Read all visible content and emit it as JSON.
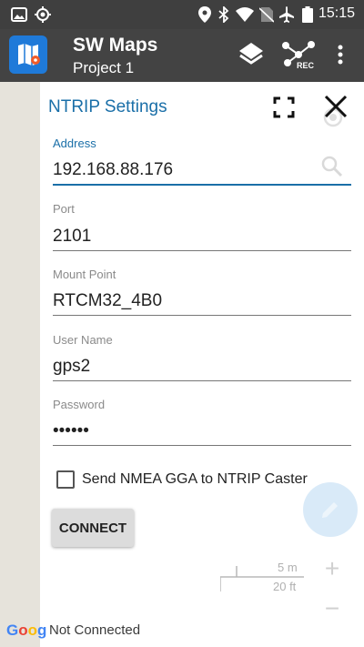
{
  "status_bar": {
    "time": "15:15",
    "icons": [
      "image-icon",
      "gps-target-icon",
      "location-pin-icon",
      "bluetooth-icon",
      "wifi-icon",
      "no-sim-icon",
      "airplane-icon",
      "battery-icon"
    ]
  },
  "app_bar": {
    "title": "SW Maps",
    "subtitle": "Project 1",
    "actions": [
      "layers-icon",
      "record-track-icon",
      "more-vert-icon"
    ],
    "rec_label": "REC"
  },
  "dialog": {
    "title": "NTRIP Settings",
    "fields": {
      "address": {
        "label": "Address",
        "value": "192.168.88.176"
      },
      "port": {
        "label": "Port",
        "value": "2101"
      },
      "mount_point": {
        "label": "Mount Point",
        "value": "RTCM32_4B0"
      },
      "user_name": {
        "label": "User Name",
        "value": "gps2"
      },
      "password": {
        "label": "Password",
        "value": "••••••"
      }
    },
    "checkbox": {
      "label": "Send NMEA GGA to NTRIP Caster",
      "checked": false
    },
    "connect_label": "CONNECT"
  },
  "map": {
    "scale_metric": "5 m",
    "scale_imperial": "20 ft",
    "zoom_in": "+",
    "zoom_out": "−",
    "google_logo": "Goog",
    "connection_status": "Not Connected"
  },
  "colors": {
    "accent": "#1a6fa8",
    "app_bar": "#434343",
    "status_bar": "#3f3f3f",
    "logo_blue": "#1f7ad9"
  }
}
